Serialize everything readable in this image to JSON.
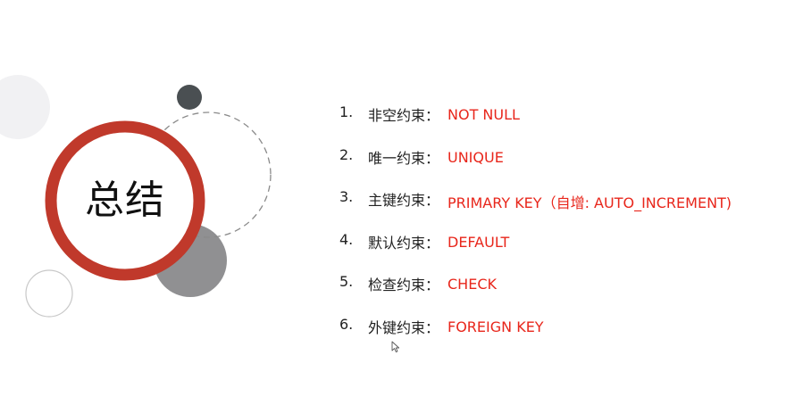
{
  "slide": {
    "title": "总结",
    "items": [
      {
        "number": "1.",
        "label": "非空约束：",
        "value": "NOT  NULL"
      },
      {
        "number": "2.",
        "label": "唯一约束：",
        "value": "UNIQUE"
      },
      {
        "number": "3.",
        "label": "主键约束：",
        "value": "PRIMARY KEY（自增: AUTO_INCREMENT)"
      },
      {
        "number": "4.",
        "label": "默认约束：",
        "value": "DEFAULT"
      },
      {
        "number": "5.",
        "label": "检查约束：",
        "value": "CHECK"
      },
      {
        "number": "6.",
        "label": "外键约束：",
        "value": "FOREIGN KEY"
      }
    ]
  },
  "colors": {
    "accent_red": "#e8261b",
    "ring_red": "#c0392b",
    "dark_circle": "#4a4f52",
    "gray_circle": "#909092",
    "light_circle": "#f1f1f3"
  },
  "icons": {
    "cursor": "mouse-pointer-icon"
  }
}
